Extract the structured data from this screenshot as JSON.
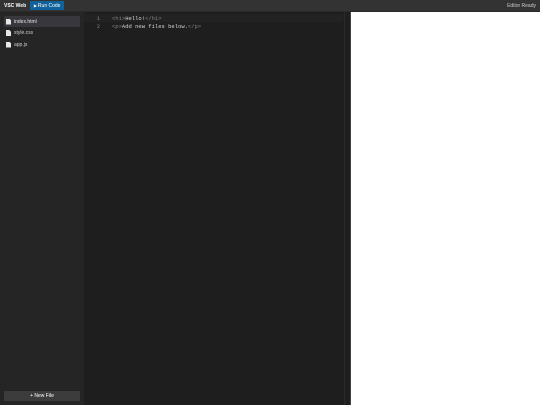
{
  "header": {
    "app_title": "VSC Web",
    "run_button_label": "Run Code",
    "status": "Editor Ready"
  },
  "sidebar": {
    "files": [
      {
        "name": "index.html",
        "active": true
      },
      {
        "name": "style.css",
        "active": false
      },
      {
        "name": "app.js",
        "active": false
      }
    ],
    "new_file_label": "+ New File"
  },
  "editor": {
    "lines": [
      {
        "number": "1",
        "open_tag": "<h1>",
        "text": "Hello!",
        "close_tag": "</h1>"
      },
      {
        "number": "2",
        "open_tag": "<p>",
        "text": "Add new files below.",
        "close_tag": "</p>"
      }
    ]
  },
  "colors": {
    "accent": "#0e639c",
    "topbar": "#333333",
    "sidebar": "#252526",
    "editor_bg": "#1e1e1e",
    "preview_bg": "#ffffff"
  },
  "icons": {
    "file": "file-icon",
    "run": "play-icon"
  }
}
